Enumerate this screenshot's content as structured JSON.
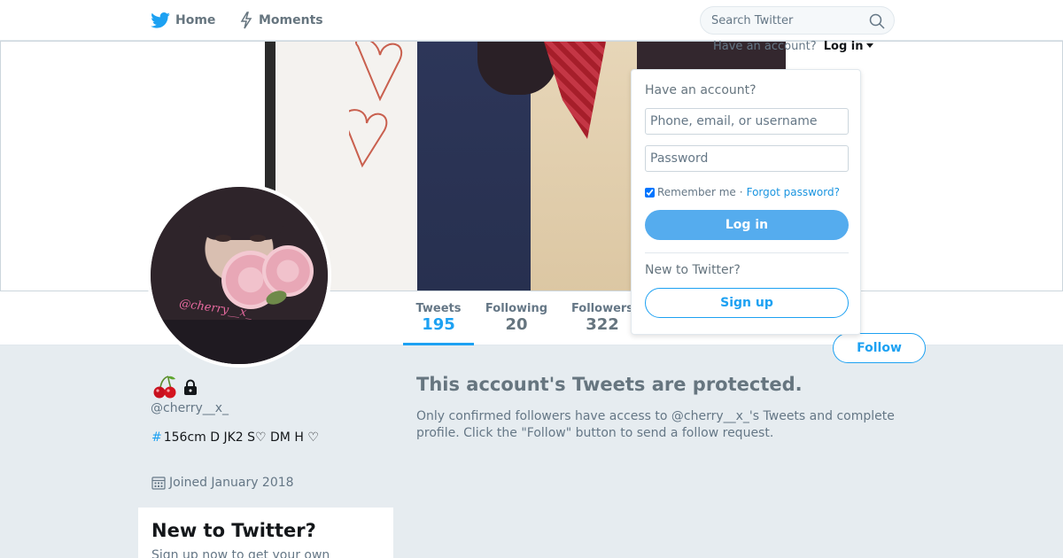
{
  "nav": {
    "home_label": "Home",
    "moments_label": "Moments",
    "search_placeholder": "Search Twitter"
  },
  "login_hint": {
    "text": "Have an account?",
    "login_label": "Log in"
  },
  "profile": {
    "emoji_icons": [
      "cherry-icon",
      "lock-icon"
    ],
    "handle": "@cherry__x_",
    "avatar_handle_text": "@cherry__x_",
    "bio_hashtag_symbol": "#",
    "bio": "156cm D JK2 S♡ DM H ♡",
    "joined": "Joined January 2018"
  },
  "stats": [
    {
      "label": "Tweets",
      "value": "195"
    },
    {
      "label": "Following",
      "value": "20"
    },
    {
      "label": "Followers",
      "value": "322"
    }
  ],
  "follow_label": "Follow",
  "protected": {
    "title": "This account's Tweets are protected.",
    "body": "Only confirmed followers have access to @cherry__x_'s Tweets and complete profile. Click the \"Follow\" button to send a follow request."
  },
  "new_to_twitter_box": {
    "title": "New to Twitter?",
    "subtitle": "Sign up now to get your own"
  },
  "login_dropdown": {
    "question": "Have an account?",
    "username_placeholder": "Phone, email, or username",
    "password_placeholder": "Password",
    "remember_label": "Remember me",
    "separator": "·",
    "forgot_label": "Forgot password?",
    "login_button": "Log in",
    "new_question": "New to Twitter?",
    "signup_button": "Sign up"
  },
  "colors": {
    "accent": "#1da1f2",
    "login_button": "#55acee",
    "background": "#e6ecf0"
  }
}
